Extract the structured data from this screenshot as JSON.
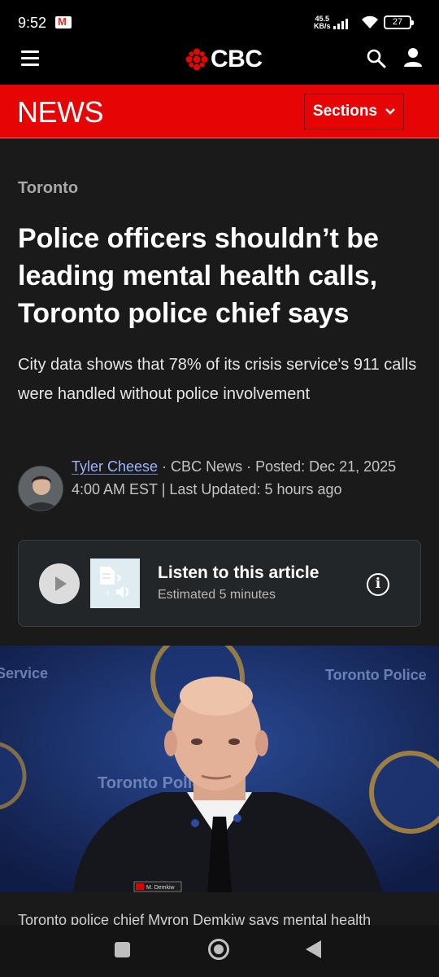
{
  "status_bar": {
    "time": "9:52",
    "gmail_icon": "M",
    "net_speed": "45.5",
    "net_unit": "KB/s",
    "battery": "27"
  },
  "header": {
    "logo_text": "CBC",
    "news_label": "NEWS",
    "sections_label": "Sections"
  },
  "article": {
    "kicker": "Toronto",
    "headline": "Police officers shouldn’t be leading mental health calls, Toronto police chief says",
    "dek": "City data shows that 78% of its crisis service's 911 calls were handled without police involvement",
    "author": "Tyler Cheese",
    "byline_rest": " · CBC News · Posted: Dec 21, 2025 4:00 AM EST | Last Updated: 5 hours ago"
  },
  "listen": {
    "title": "Listen to this article",
    "subtitle": "Estimated 5 minutes"
  },
  "photo": {
    "badge": "M. Demkiw",
    "backdrop_left": "Service",
    "backdrop_right": "Toronto Police",
    "backdrop_center": "Toronto Police"
  },
  "caption": "Toronto police chief Myron Demkiw says mental health",
  "colors": {
    "accent_red": "#e60505",
    "author_link": "#9db4ff",
    "background": "#1a1a1a"
  },
  "icons": [
    "menu-icon",
    "cbc-gem-icon",
    "search-icon",
    "user-icon",
    "chevron-down-icon",
    "play-icon",
    "text-to-speech-icon",
    "info-icon"
  ]
}
